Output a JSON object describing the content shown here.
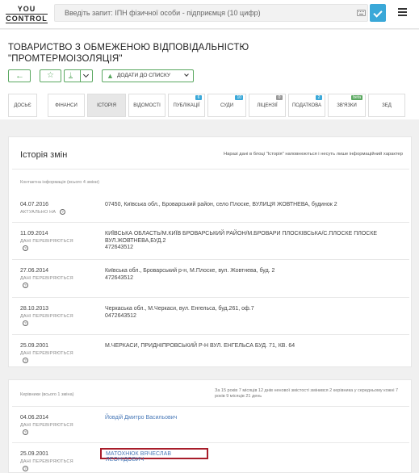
{
  "header": {
    "logo_line1": "YOU",
    "logo_line2": "CONTROL",
    "search_placeholder": "Введіть запит: ІПН фізичної особи - підприємця (10 цифр)",
    "icons": [
      "keyboard-icon",
      "checkmark-icon",
      "hamburger-menu-icon"
    ]
  },
  "company": {
    "title": "ТОВАРИСТВО З ОБМЕЖЕНОЮ ВІДПОВІДАЛЬНІСТЮ \"ПРОМТЕРМОІЗОЛЯЦІЯ\"",
    "add_to_list": "ДОДАТИ ДО СПИСКУ"
  },
  "tabs": [
    {
      "label": "ДОСЬЄ",
      "badge": ""
    },
    {
      "label": "ФІНАНСИ",
      "badge": ""
    },
    {
      "label": "ІСТОРІЯ",
      "badge": ""
    },
    {
      "label": "ВІДОМОСТІ",
      "badge": ""
    },
    {
      "label": "ПУБЛІКАЦІЇ",
      "badge": "6"
    },
    {
      "label": "СУДИ",
      "badge": "10"
    },
    {
      "label": "ЛІЦЕНЗІЇ",
      "badge": "0"
    },
    {
      "label": "ПОДАТКОВА",
      "badge": "2"
    },
    {
      "label": "ЗВ'ЯЗКИ",
      "badge": "beta"
    },
    {
      "label": "ЗЕД",
      "badge": ""
    }
  ],
  "colors": {
    "accent": "#3aa8d8",
    "green": "#5aa860",
    "highlight": "#a81d2a",
    "link": "#4a7ab8"
  },
  "history": {
    "title": "Історія змін",
    "note": "Наразі дані в блоці \"Історія\" наповнюються і несуть лише інформаційний характер",
    "contacts_caption": "Контактна інформація (всього 4 зміни)",
    "rows": [
      {
        "date": "04.07.2016",
        "status": "АКТУАЛЬНО НА",
        "address": "07450, Київська обл., Броварський район, село Плоске, ВУЛИЦЯ ЖОВТНЕВА, будинок 2",
        "phone": ""
      },
      {
        "date": "11.09.2014",
        "status": "ДАНІ ПЕРЕВІРЯЮТЬСЯ",
        "address": "КИЇВСЬКА ОБЛАСТЬ/М.КИЇВ БРОВАРСЬКИЙ РАЙОН/М.БРОВАРИ ПЛОСКІВСЬКА/С.ПЛОСКЕ ПЛОСКЕ ВУЛ.ЖОВТНЕВА,БУД.2",
        "phone": "472643512"
      },
      {
        "date": "27.06.2014",
        "status": "ДАНІ ПЕРЕВІРЯЮТЬСЯ",
        "address": "Київська обл., Броварський р-н, М.Плоске, вул. Жовтнева, буд. 2",
        "phone": "472643512"
      },
      {
        "date": "28.10.2013",
        "status": "ДАНІ ПЕРЕВІРЯЮТЬСЯ",
        "address": "Черкаська обл., М.Черкаси, вул. Енгельса, буд.261, оф.7",
        "phone": "0472643512"
      },
      {
        "date": "25.09.2001",
        "status": "ДАНІ ПЕРЕВІРЯЮТЬСЯ",
        "address": "М.ЧЕРКАСИ, ПРИДНІПРОВСЬКИЙ Р-Н ВУЛ. ЕНГЕЛЬСА БУД. 71, КВ. 64",
        "phone": ""
      }
    ]
  },
  "directors": {
    "caption": "Керівники (всього 1 зміна)",
    "note": "За 15 років 7 місяців 12 днів ненової змістості змінився 2 керівника у середньому кожні 7 років 9 місяців 21 день",
    "rows": [
      {
        "date": "04.06.2014",
        "status": "ДАНІ ПЕРЕВІРЯЮТЬСЯ",
        "name": "Йовдій Дмитро Васильович"
      },
      {
        "date": "25.09.2001",
        "status": "ДАНІ ПЕРЕВІРЯЮТЬСЯ",
        "name": "МАТОХНЮК ВЯЧЕСЛАВ ЛЕОНІДОВИЧ"
      }
    ]
  }
}
